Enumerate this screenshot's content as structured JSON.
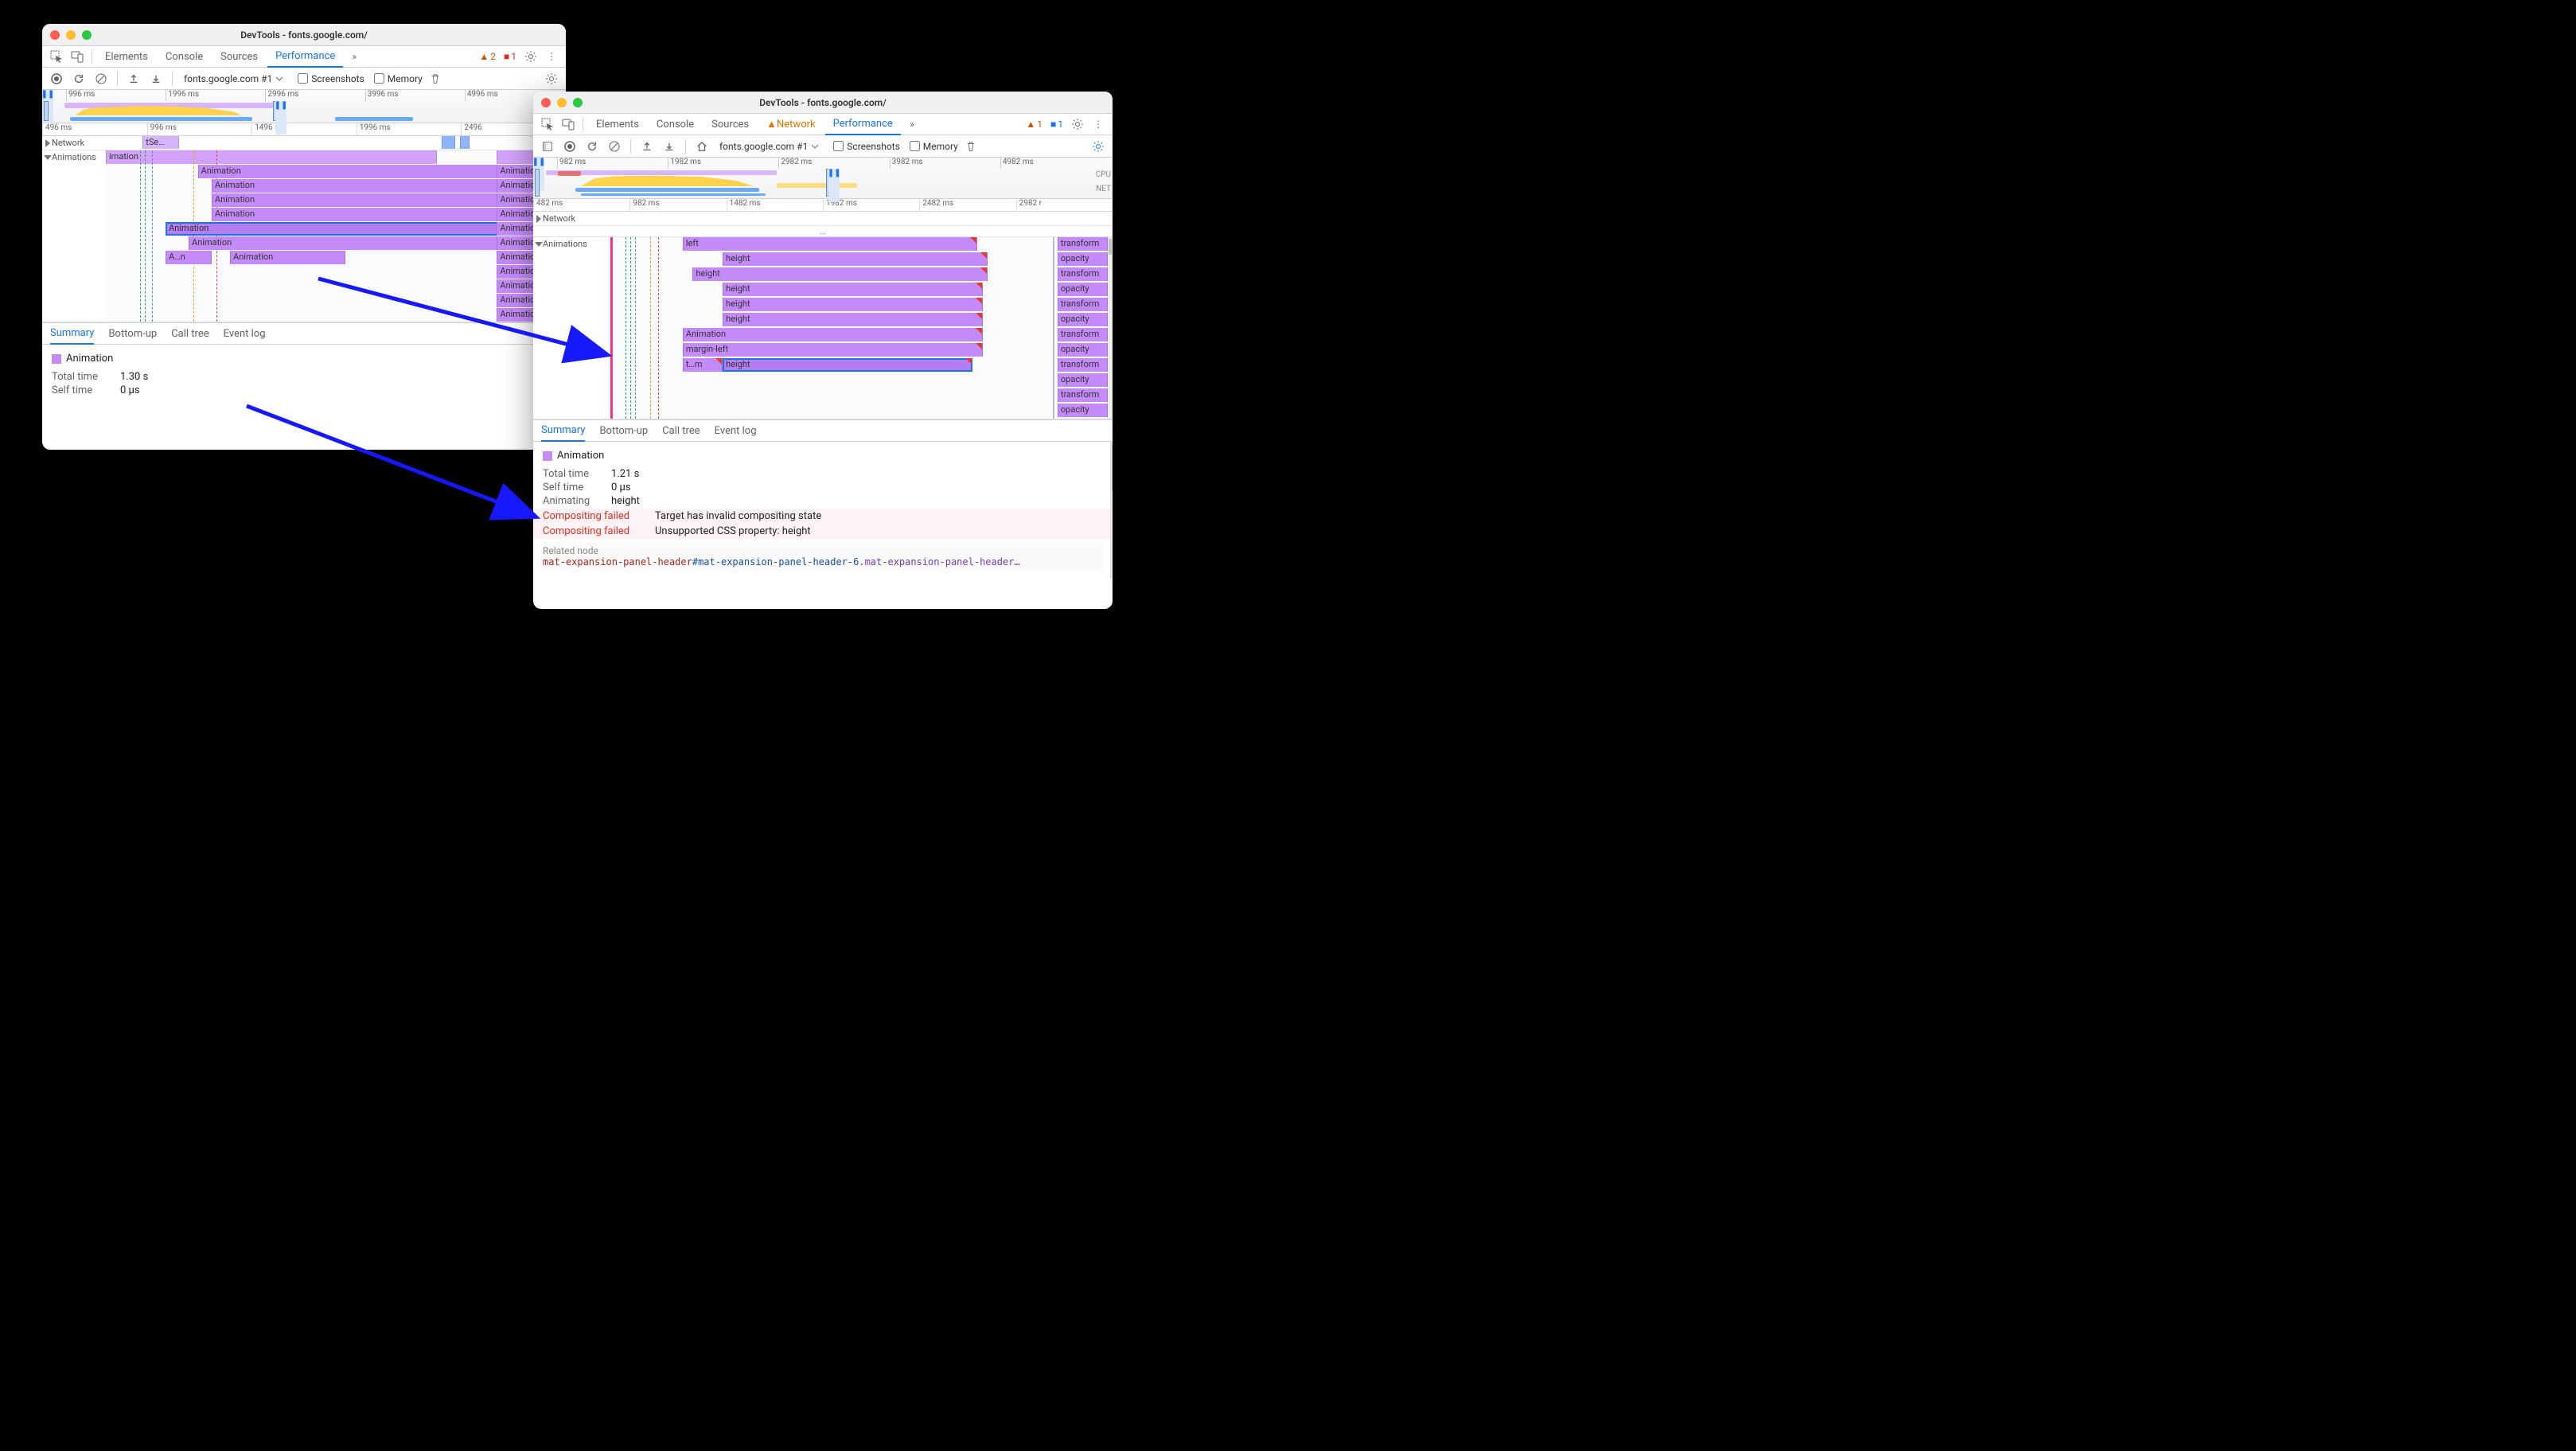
{
  "window1": {
    "title": "DevTools - fonts.google.com/",
    "tabs": [
      "Elements",
      "Console",
      "Sources",
      "Performance"
    ],
    "active_tab": "Performance",
    "warn_count": "2",
    "err_count": "1",
    "rec_target": "fonts.google.com #1",
    "checkboxes": {
      "screenshots": "Screenshots",
      "memory": "Memory"
    },
    "overview_ticks": [
      "996 ms",
      "1996 ms",
      "2996 ms",
      "3996 ms",
      "4996 ms"
    ],
    "ruler": [
      "496 ms",
      "996 ms",
      "1496 ms",
      "1996 ms",
      "2496"
    ],
    "tracks": {
      "network": "Network",
      "animations": "Animations"
    },
    "network_item": "tSe…",
    "anim_header": "imation",
    "flame_left": [
      {
        "row": 0,
        "l": 20,
        "w": 70,
        "t": "Animation"
      },
      {
        "row": 0,
        "lr": 0,
        "wr": 15,
        "t": "Animation",
        "r": true
      },
      {
        "row": 1,
        "l": 23,
        "w": 69,
        "t": "Animation"
      },
      {
        "row": 1,
        "lr": 0,
        "wr": 15,
        "t": "Animation",
        "r": true
      },
      {
        "row": 2,
        "l": 23,
        "w": 68,
        "t": "Animation"
      },
      {
        "row": 2,
        "lr": 0,
        "wr": 15,
        "t": "Animation",
        "r": true
      },
      {
        "row": 3,
        "l": 23,
        "w": 68,
        "t": "Animation"
      },
      {
        "row": 3,
        "lr": 0,
        "wr": 15,
        "t": "Animation",
        "r": true
      },
      {
        "row": 4,
        "l": 13,
        "w": 78,
        "t": "Animation",
        "sel": true
      },
      {
        "row": 4,
        "lr": 0,
        "wr": 15,
        "t": "Animation",
        "r": true
      },
      {
        "row": 5,
        "l": 18,
        "w": 75,
        "t": "Animation"
      },
      {
        "row": 5,
        "lr": 0,
        "wr": 15,
        "t": "Animation",
        "r": true
      },
      {
        "row": 6,
        "l": 13,
        "w": 10,
        "t": "A…n"
      },
      {
        "row": 6,
        "l": 27,
        "w": 25,
        "t": "Animation"
      },
      {
        "row": 6,
        "lr": 0,
        "wr": 15,
        "t": "Animation",
        "r": true
      },
      {
        "row": 7,
        "lr": 0,
        "wr": 15,
        "t": "Animation",
        "r": true
      },
      {
        "row": 8,
        "lr": 0,
        "wr": 15,
        "t": "Animation",
        "r": true
      },
      {
        "row": 9,
        "lr": 0,
        "wr": 15,
        "t": "Animation",
        "r": true
      },
      {
        "row": 10,
        "lr": 0,
        "wr": 15,
        "t": "Animation",
        "r": true
      }
    ],
    "dtabs": [
      "Summary",
      "Bottom-up",
      "Call tree",
      "Event log"
    ],
    "active_dtab": "Summary",
    "summary_title": "Animation",
    "total_label": "Total time",
    "total_value": "1.30 s",
    "self_label": "Self time",
    "self_value": "0 μs"
  },
  "window2": {
    "title": "DevTools - fonts.google.com/",
    "tabs": [
      "Elements",
      "Console",
      "Sources",
      "Network",
      "Performance"
    ],
    "active_tab": "Performance",
    "network_warn": true,
    "warn_count": "1",
    "info_count": "1",
    "rec_target": "fonts.google.com #1",
    "checkboxes": {
      "screenshots": "Screenshots",
      "memory": "Memory"
    },
    "overview_ticks": [
      "982 ms",
      "1982 ms",
      "2982 ms",
      "3982 ms",
      "4982 ms"
    ],
    "side_labels": {
      "cpu": "CPU",
      "net": "NET"
    },
    "ruler": [
      "482 ms",
      "982 ms",
      "1482 ms",
      "1982 ms",
      "2482 ms",
      "2982 r"
    ],
    "tracks": {
      "network": "Network",
      "animations": "Animations"
    },
    "ellipsis": "…",
    "flame_left": [
      {
        "row": 0,
        "l": 14,
        "w": 59,
        "t": "left",
        "tip": true
      },
      {
        "row": 1,
        "l": 22,
        "w": 53,
        "t": "height",
        "tip": true
      },
      {
        "row": 2,
        "l": 16,
        "w": 59,
        "t": "height",
        "tip": true
      },
      {
        "row": 3,
        "l": 22,
        "w": 52,
        "t": "height",
        "tip": true
      },
      {
        "row": 4,
        "l": 22,
        "w": 52,
        "t": "height",
        "tip": true
      },
      {
        "row": 5,
        "l": 22,
        "w": 52,
        "t": "height",
        "tip": true
      },
      {
        "row": 6,
        "l": 14,
        "w": 60,
        "t": "Animation",
        "tip": true
      },
      {
        "row": 7,
        "l": 14,
        "w": 60,
        "t": "margin-left",
        "tip": true
      },
      {
        "row": 8,
        "l": 14,
        "w": 8,
        "t": "t…m",
        "tip": true
      },
      {
        "row": 8,
        "l": 22,
        "w": 50,
        "t": "height",
        "sel": true,
        "tip": true
      }
    ],
    "flame_right": [
      "transform",
      "opacity",
      "transform",
      "opacity",
      "transform",
      "opacity",
      "transform",
      "opacity",
      "transform",
      "opacity",
      "transform",
      "opacity"
    ],
    "dtabs": [
      "Summary",
      "Bottom-up",
      "Call tree",
      "Event log"
    ],
    "active_dtab": "Summary",
    "summary_title": "Animation",
    "total_label": "Total time",
    "total_value": "1.21 s",
    "self_label": "Self time",
    "self_value": "0 μs",
    "animating_label": "Animating",
    "animating_value": "height",
    "cf_label": "Compositing failed",
    "cf1": "Target has invalid compositing state",
    "cf2": "Unsupported CSS property: height",
    "related_label": "Related node",
    "node_tag": "mat-expansion-panel-header",
    "node_id": "#mat-expansion-panel-header-6",
    "node_class": ".mat-expansion-panel-header…"
  }
}
